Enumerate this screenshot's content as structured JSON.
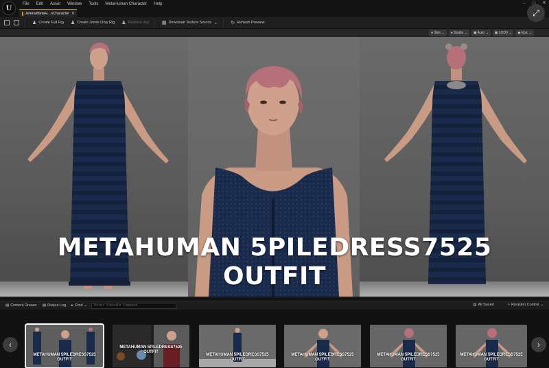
{
  "menu": [
    "File",
    "Edit",
    "Asset",
    "Window",
    "Tools",
    "MetaHuman Character",
    "Help"
  ],
  "tab": {
    "label": "JelenaMetaH...nCharacter"
  },
  "toolbar": {
    "create_full_rig": "Create Full Rig",
    "create_joints_rig": "Create Joints Only Rig",
    "remove_rig": "Remove Rig",
    "download_texture": "Download Texture Source",
    "refresh_preview": "Refresh Preview"
  },
  "viewport_options": [
    "Skin",
    "Studio",
    "Auto",
    "LOD0",
    "Epic"
  ],
  "overlay": {
    "line1": "METAHUMAN 5PILEDRESS7525",
    "line2": "OUTFIT"
  },
  "bottombar": {
    "content_drawer": "Content Drawer",
    "output_log": "Output Log",
    "cmd": "Cmd",
    "console_placeholder": "Enter Console Command",
    "all_saved": "All Saved",
    "revision_control": "Revision Control"
  },
  "gallery": {
    "captions": [
      "METAHUMAN 5PILEDRESS7525 OUTFIT",
      "METAHUMAN 5PILEDRESS7525 OUTFIT",
      "METAHUMAN 5PILEDRESS7525 OUTFIT",
      "METAHUMAN 5PILEDRESS7525 OUTFIT",
      "METAHUMAN 5PILEDRESS7525 OUTFIT",
      "METAHUMAN 5PILEDRESS7525 OUTFIT"
    ]
  },
  "colors": {
    "accent_tab": "#e0a030",
    "dress": "#1a2a4a",
    "skin": "#c99a84",
    "hair": "#b6707a"
  }
}
